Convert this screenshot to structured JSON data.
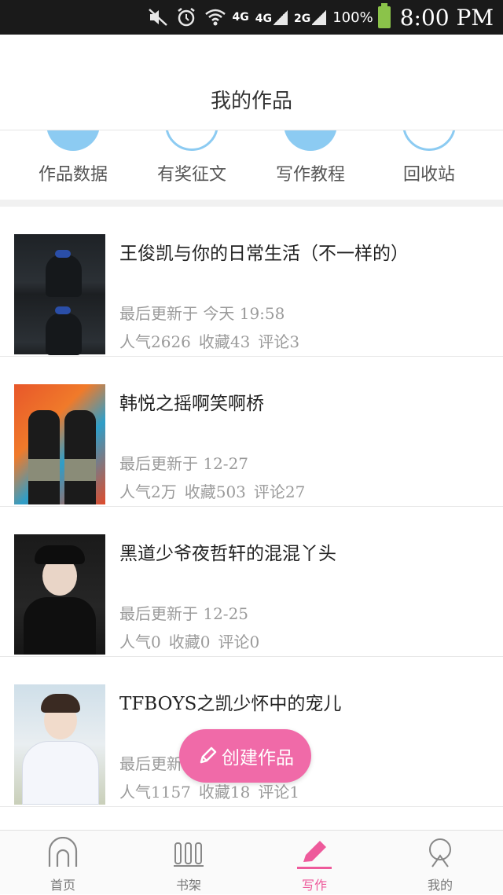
{
  "status_bar": {
    "network_1": "4G",
    "network_2": "4G",
    "network_3": "2G",
    "battery": "100%",
    "time": "8:00 PM"
  },
  "header": {
    "title": "我的作品"
  },
  "tools": [
    {
      "label": "作品数据",
      "icon": "chart-icon"
    },
    {
      "label": "有奖征文",
      "icon": "document-icon"
    },
    {
      "label": "写作教程",
      "icon": "chat-icon"
    },
    {
      "label": "回收站",
      "icon": "trash-icon"
    }
  ],
  "works": [
    {
      "title": "王俊凯与你的日常生活（不一样的）",
      "update": "最后更新于 今天 19:58",
      "popularity": "人气2626",
      "favorites": "收藏43",
      "comments": "评论3"
    },
    {
      "title": "韩悦之摇啊笑啊桥",
      "update": "最后更新于 12-27",
      "popularity": "人气2万",
      "favorites": "收藏503",
      "comments": "评论27"
    },
    {
      "title": "黑道少爷夜哲轩的混混丫头",
      "update": "最后更新于 12-25",
      "popularity": "人气0",
      "favorites": "收藏0",
      "comments": "评论0"
    },
    {
      "title": "TFBOYS之凯少怀中的宠儿",
      "update": "最后更新于 12-27",
      "popularity": "人气1157",
      "favorites": "收藏18",
      "comments": "评论1"
    }
  ],
  "fab": {
    "label": "创建作品",
    "icon": "pencil-icon"
  },
  "bottom_nav": [
    {
      "label": "首页",
      "icon": "home-icon",
      "active": false
    },
    {
      "label": "书架",
      "icon": "bookshelf-icon",
      "active": false
    },
    {
      "label": "写作",
      "icon": "pencil-icon",
      "active": true
    },
    {
      "label": "我的",
      "icon": "profile-icon",
      "active": false
    }
  ],
  "colors": {
    "accent": "#ee5a9b",
    "tool_icon": "#8ccbf2",
    "fab": "#f06aa8"
  }
}
